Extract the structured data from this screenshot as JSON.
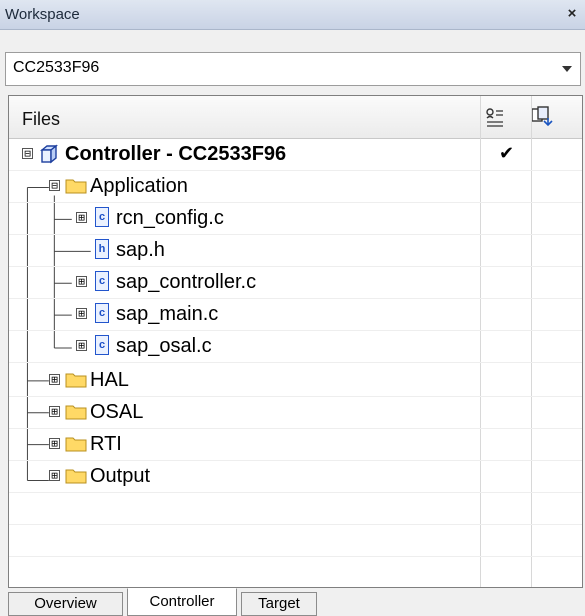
{
  "window": {
    "title": "Workspace",
    "close_label": "×"
  },
  "config": {
    "selected": "CC2533F96"
  },
  "header": {
    "files_label": "Files"
  },
  "tree": {
    "project": {
      "label": "Controller - CC2533F96",
      "checked": "✔"
    },
    "application": {
      "label": "Application"
    },
    "app_files": [
      {
        "label": "rcn_config.c",
        "type": "c"
      },
      {
        "label": "sap.h",
        "type": "h"
      },
      {
        "label": "sap_controller.c",
        "type": "c"
      },
      {
        "label": "sap_main.c",
        "type": "c"
      },
      {
        "label": "sap_osal.c",
        "type": "c"
      }
    ],
    "groups": [
      {
        "label": "HAL"
      },
      {
        "label": "OSAL"
      },
      {
        "label": "RTI"
      },
      {
        "label": "Output"
      }
    ]
  },
  "tabs": [
    {
      "label": "Overview",
      "active": false
    },
    {
      "label": "Controller",
      "active": true
    },
    {
      "label": "Target",
      "active": false
    }
  ],
  "icons": {
    "folder_color": "#ffd966",
    "c_file_letter": "c",
    "h_file_letter": "h",
    "expand_plus": "⊞",
    "collapse_minus": "⊟"
  }
}
